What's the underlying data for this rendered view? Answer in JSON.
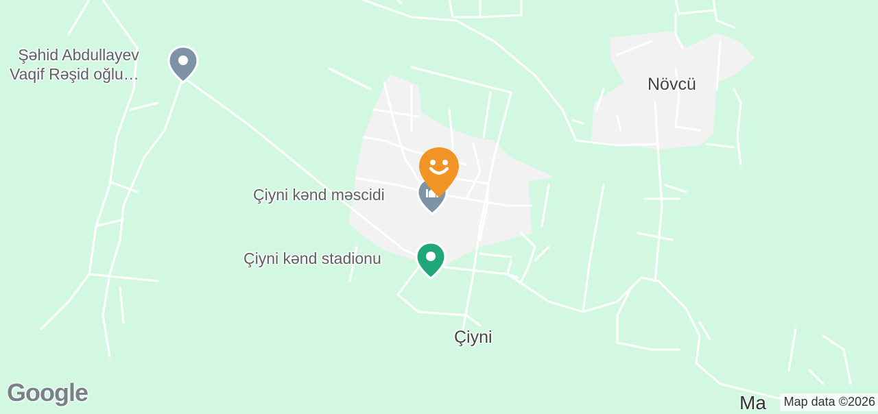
{
  "map": {
    "background_color": "#d3f8e2",
    "settlement_color": "#f2f2f2",
    "road_color": "#ffffff"
  },
  "places": {
    "town_main": "Çiyni",
    "town_ne": "Növcü",
    "town_se_cut": "Ma"
  },
  "pois": [
    {
      "label_line1": "Şəhid Abdullayev",
      "label_line2": "Vaqif Rəşid oğlu…",
      "icon": "grey-location-pin-icon"
    },
    {
      "label": "Çiyni kənd məscidi",
      "icon": "mosque-pin-icon"
    },
    {
      "label": "Çiyni kənd stadionu",
      "icon": "green-location-pin-icon"
    }
  ],
  "user_marker": {
    "icon": "smiley-marker-icon",
    "color": "#f29423"
  },
  "branding": {
    "logo": "Google",
    "attribution": "Map data ©2026"
  }
}
